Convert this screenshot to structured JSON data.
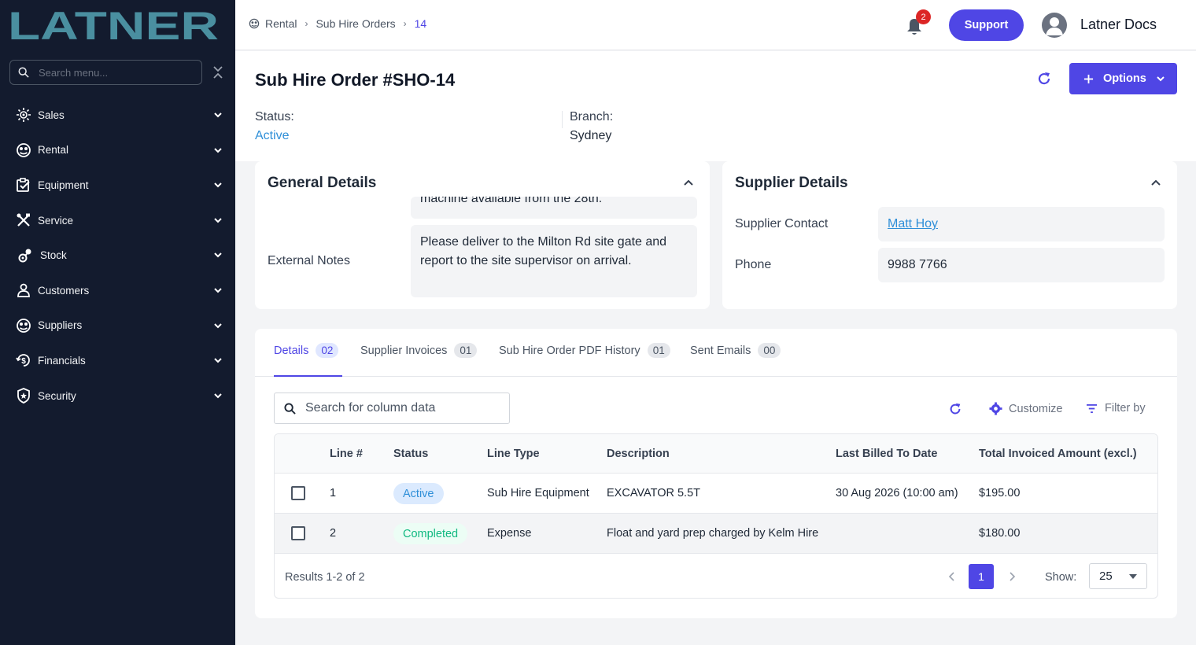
{
  "brand": {
    "logo_text": "LATNER"
  },
  "sidebar": {
    "search_placeholder": "Search menu...",
    "items": [
      {
        "label": "Sales",
        "icon": "sales-icon"
      },
      {
        "label": "Rental",
        "icon": "rental-icon"
      },
      {
        "label": "Equipment",
        "icon": "equipment-icon"
      },
      {
        "label": "Service",
        "icon": "service-icon"
      },
      {
        "label": "Stock",
        "icon": "stock-icon"
      },
      {
        "label": "Customers",
        "icon": "customers-icon"
      },
      {
        "label": "Suppliers",
        "icon": "suppliers-icon"
      },
      {
        "label": "Financials",
        "icon": "financials-icon"
      },
      {
        "label": "Security",
        "icon": "security-icon"
      }
    ]
  },
  "topbar": {
    "breadcrumb": [
      "Rental",
      "Sub Hire Orders",
      "14"
    ],
    "notification_count": "2",
    "support_label": "Support",
    "user_name": "Latner Docs"
  },
  "header": {
    "title": "Sub Hire Order",
    "number": "#SHO-14",
    "options_label": "Options",
    "status_label": "Status:",
    "status_value": "Active",
    "branch_label": "Branch:",
    "branch_value": "Sydney"
  },
  "general_details": {
    "title": "General Details",
    "prev_note": "machine available from the 28th.",
    "external_notes_label": "External Notes",
    "external_notes_value": "Please deliver to the Milton Rd site gate and report to the site supervisor on arrival."
  },
  "supplier_details": {
    "title": "Supplier Details",
    "contact_label": "Supplier Contact",
    "contact_value": "Matt Hoy",
    "phone_label": "Phone",
    "phone_value": "9988 7766"
  },
  "tabs": [
    {
      "label": "Details",
      "count": "02"
    },
    {
      "label": "Supplier Invoices",
      "count": "01"
    },
    {
      "label": "Sub Hire Order PDF History",
      "count": "01"
    },
    {
      "label": "Sent Emails",
      "count": "00"
    }
  ],
  "toolbar": {
    "search_placeholder": "Search for column data",
    "customize_label": "Customize",
    "filter_label": "Filter by"
  },
  "table": {
    "columns": [
      "Line #",
      "Status",
      "Line Type",
      "Description",
      "Last Billed To Date",
      "Total Invoiced Amount (excl.)"
    ],
    "rows": [
      {
        "line": "1",
        "status": "Active",
        "type": "Sub Hire Equipment",
        "description": "EXCAVATOR 5.5T",
        "billed": "30 Aug 2026 (10:00 am)",
        "amount": "$195.00"
      },
      {
        "line": "2",
        "status": "Completed",
        "type": "Expense",
        "description": "Float and yard prep charged by Kelm Hire",
        "billed": "",
        "amount": "$180.00"
      }
    ]
  },
  "pagination": {
    "results": "Results 1-2 of 2",
    "current_page": "1",
    "show_label": "Show:",
    "page_size": "25"
  },
  "colors": {
    "sidebar_bg": "#131b2e",
    "accent": "#4f46e5",
    "logo": "#4a8fa0",
    "link": "#2f8fd8"
  }
}
